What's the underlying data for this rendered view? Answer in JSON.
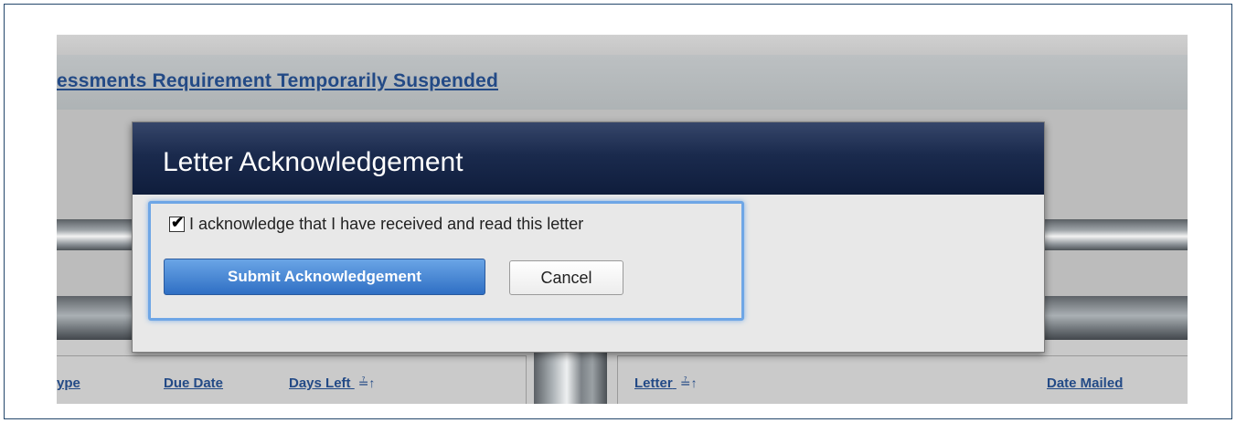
{
  "background": {
    "page_title": "essments Requirement Temporarily Suspended",
    "columns_left": [
      {
        "label": "ype",
        "sortable": false
      },
      {
        "label": "Due Date",
        "sortable": false
      },
      {
        "label": "Days Left",
        "sortable": true,
        "sort_icon": "sort-ascending-icon"
      }
    ],
    "columns_right": [
      {
        "label": "Letter",
        "sortable": true,
        "sort_icon": "sort-ascending-icon"
      },
      {
        "label": "Date Mailed",
        "sortable": false
      }
    ]
  },
  "modal": {
    "title": "Letter Acknowledgement",
    "acknowledge_label": "I acknowledge that I have received and read this letter",
    "acknowledge_checked": true,
    "submit_label": "Submit Acknowledgement",
    "cancel_label": "Cancel"
  },
  "colors": {
    "link": "#234a86",
    "modal_header": "#1a2a4d",
    "primary_button": "#2f6fc4",
    "focus_outline": "#6ea6e6"
  },
  "icons": {
    "checkbox_mark": "✔",
    "sort": "≟↑"
  }
}
